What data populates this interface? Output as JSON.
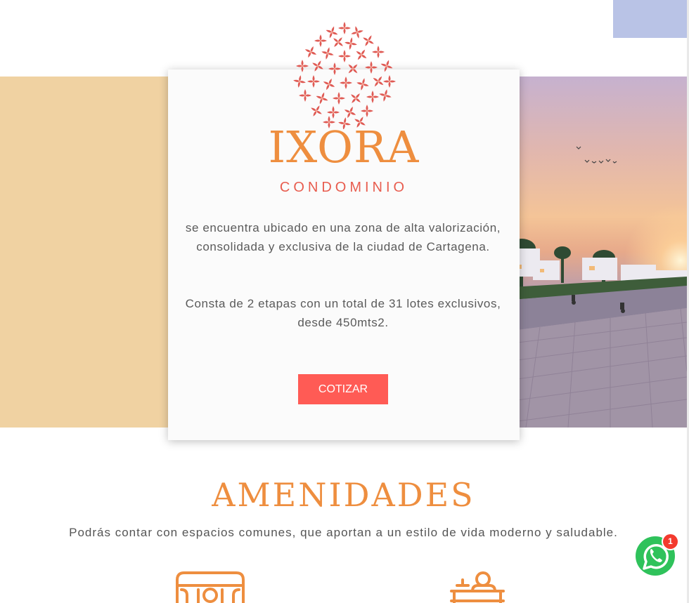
{
  "brand": {
    "name": "IXORA",
    "subtitle": "CONDOMINIO"
  },
  "intro": {
    "paragraph_1": "se encuentra ubicado en una zona de alta valorización, consolidada y exclusiva de la ciudad de Cartagena.",
    "paragraph_2": "Consta de 2 etapas con un total de 31 lotes exclusivos, desde 450mts2.",
    "cta_label": "COTIZAR"
  },
  "amenities": {
    "title": "AMENIDADES",
    "subtitle": "Podrás contar con espacios comunes, que aportan a un estilo de vida moderno y saludable."
  },
  "whatsapp": {
    "badge_count": "1",
    "icon": "whatsapp-icon"
  },
  "colors": {
    "brand_orange": "#ee8e3f",
    "brand_coral": "#e85d4f",
    "cta_red": "#ff5b55",
    "beige_panel": "#f0d2a2",
    "corner_block": "#b9c3e6",
    "whatsapp_green": "#25d366"
  }
}
